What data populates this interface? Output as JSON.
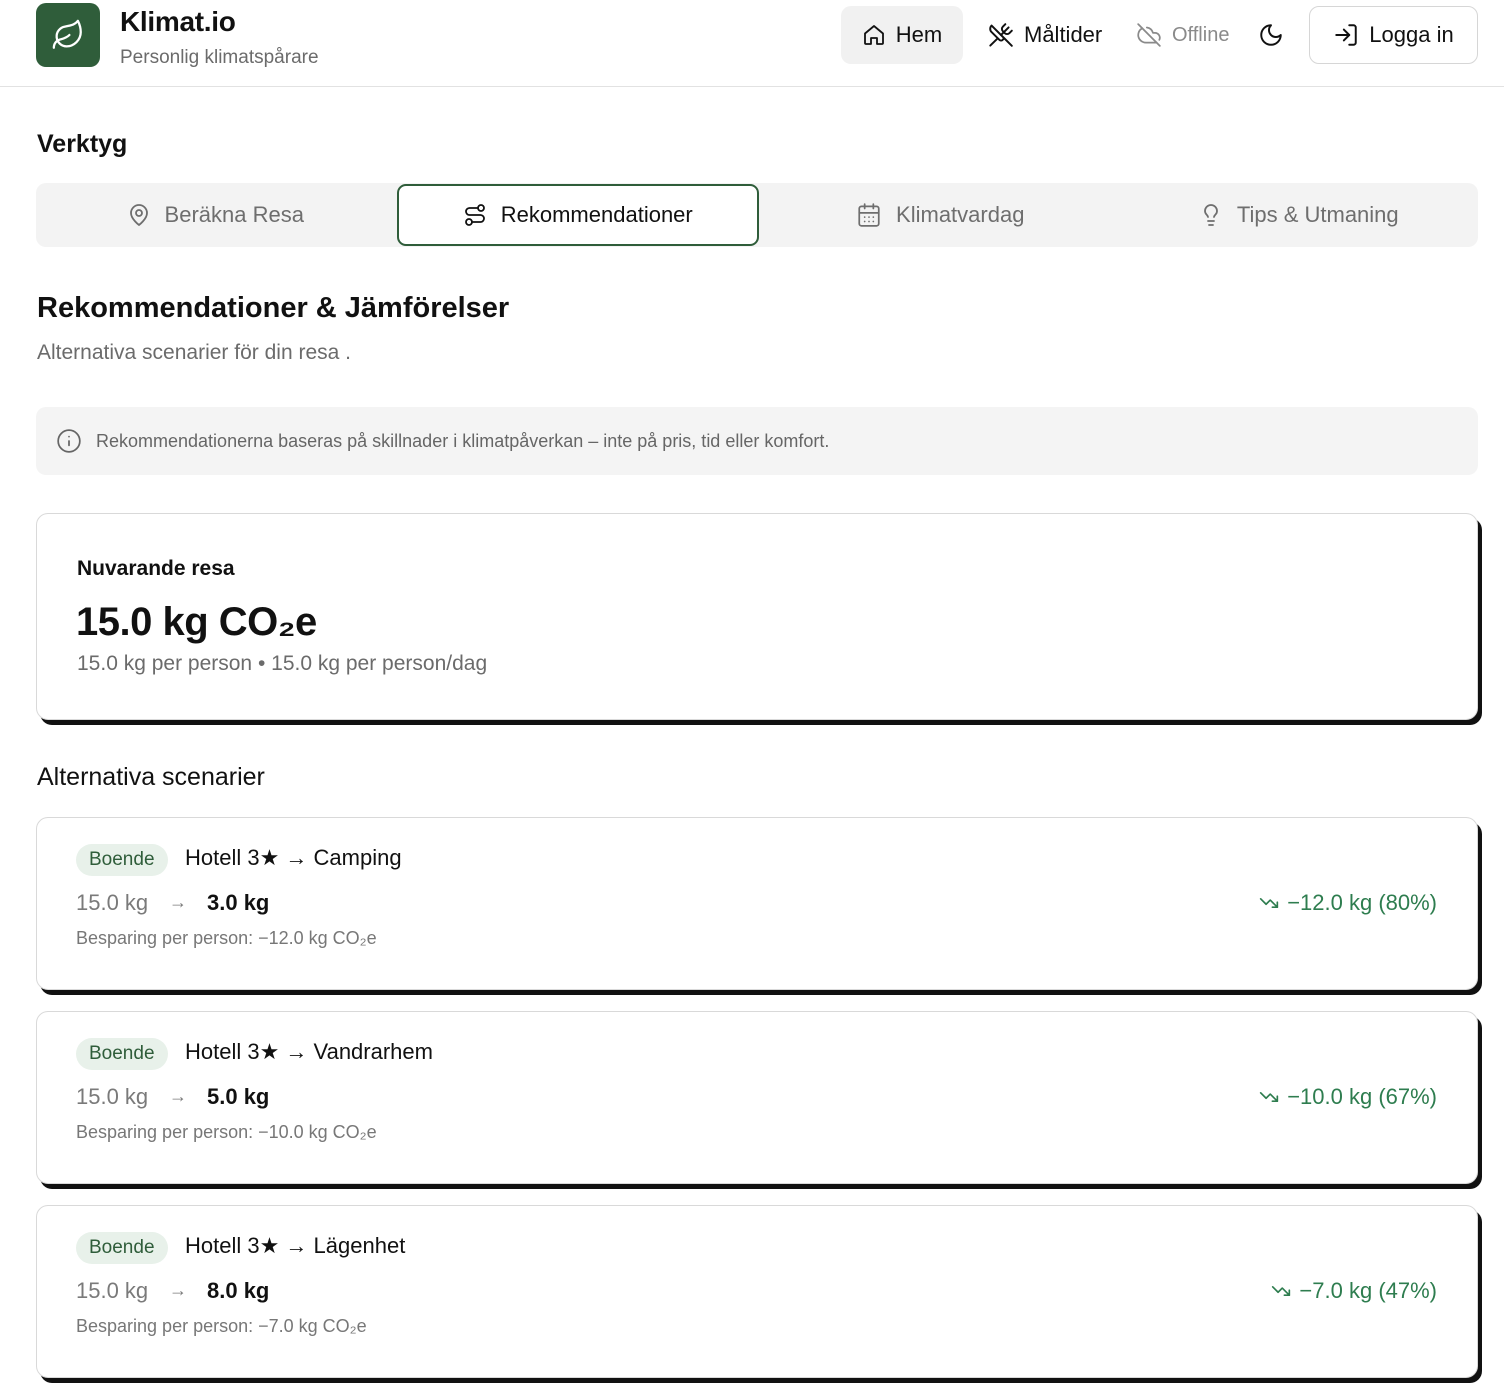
{
  "header": {
    "brand_title": "Klimat.io",
    "brand_subtitle": "Personlig klimatspårare",
    "nav": {
      "hem": "Hem",
      "maltider": "Måltider",
      "offline": "Offline",
      "login": "Logga in"
    }
  },
  "tools": {
    "label": "Verktyg",
    "tabs": [
      {
        "label": "Beräkna Resa",
        "icon": "map-pin-icon"
      },
      {
        "label": "Rekommendationer",
        "icon": "route-icon"
      },
      {
        "label": "Klimatvardag",
        "icon": "calendar-icon"
      },
      {
        "label": "Tips & Utmaning",
        "icon": "lightbulb-icon"
      }
    ]
  },
  "page": {
    "title": "Rekommendationer & Jämförelser",
    "subtitle": "Alternativa scenarier för din resa ."
  },
  "info": {
    "text": "Rekommendationerna baseras på skillnader i klimatpåverkan – inte på pris, tid eller komfort."
  },
  "current": {
    "label": "Nuvarande resa",
    "value": "15.0 kg CO₂e",
    "sub": "15.0 kg per person • 15.0 kg per person/dag"
  },
  "alternatives": {
    "title": "Alternativa scenarier",
    "items": [
      {
        "badge": "Boende",
        "title": "Hotell 3★ → Camping",
        "from": "15.0 kg",
        "arrow": "→",
        "to": "3.0 kg",
        "saving": "Besparing per person: −12.0 kg CO₂e",
        "delta": "−12.0 kg (80%)"
      },
      {
        "badge": "Boende",
        "title": "Hotell 3★ → Vandrarhem",
        "from": "15.0 kg",
        "arrow": "→",
        "to": "5.0 kg",
        "saving": "Besparing per person: −10.0 kg CO₂e",
        "delta": "−10.0 kg (67%)"
      },
      {
        "badge": "Boende",
        "title": "Hotell 3★ → Lägenhet",
        "from": "15.0 kg",
        "arrow": "→",
        "to": "8.0 kg",
        "saving": "Besparing per person: −7.0 kg CO₂e",
        "delta": "−7.0 kg (47%)"
      }
    ]
  },
  "colors": {
    "brand": "#2f5d3a",
    "success": "#2e7d4f",
    "badge_bg": "#e8f1ea"
  }
}
